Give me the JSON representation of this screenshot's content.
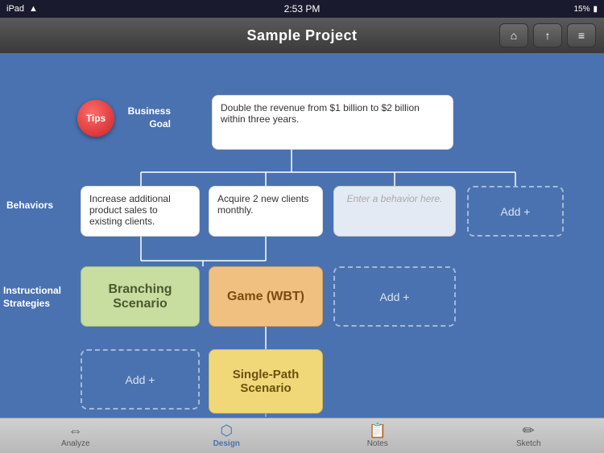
{
  "statusBar": {
    "left": "iPad",
    "time": "2:53 PM",
    "battery": "15%",
    "wifi": "WiFi"
  },
  "titleBar": {
    "title": "Sample  Project",
    "homeIcon": "🏠",
    "shareIcon": "⬆",
    "stackIcon": "☰"
  },
  "tipsButton": {
    "label": "Tips"
  },
  "businessGoal": {
    "label": "Business\nGoal",
    "content": "Double the revenue from $1 billion to $2 billion within three years."
  },
  "behaviorsLabel": "Behaviors",
  "instructionalLabel": "Instructional\nStrategies",
  "behaviors": [
    {
      "text": "Increase additional product sales to existing clients.",
      "type": "white"
    },
    {
      "text": "Acquire 2 new clients monthly.",
      "type": "white"
    },
    {
      "text": "Enter a behavior here.",
      "type": "placeholder"
    },
    {
      "text": "Add +",
      "type": "dashed"
    }
  ],
  "strategies": [
    {
      "text": "Branching Scenario",
      "type": "green"
    },
    {
      "text": "Game (WBT)",
      "type": "orange"
    },
    {
      "text": "Add +",
      "type": "dashed"
    }
  ],
  "level3": [
    {
      "text": "Add +",
      "type": "dashed"
    },
    {
      "text": "Single-Path Scenario",
      "type": "yellow"
    }
  ],
  "tabs": [
    {
      "label": "Analyze",
      "icon": "←→",
      "active": false
    },
    {
      "label": "Design",
      "icon": "⬡",
      "active": true
    },
    {
      "label": "Notes",
      "icon": "📋",
      "active": false
    },
    {
      "label": "Sketch",
      "icon": "✏",
      "active": false
    }
  ]
}
